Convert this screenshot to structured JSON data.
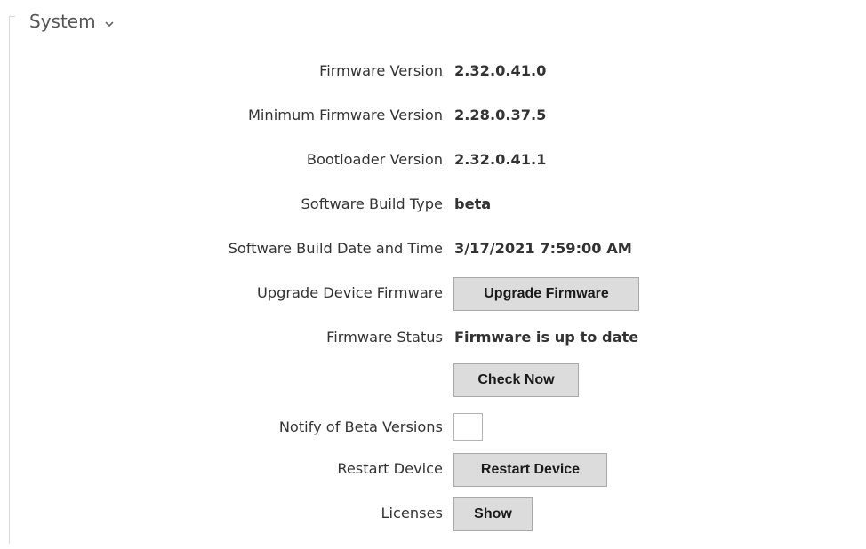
{
  "section": {
    "title": "System",
    "chevron_icon": "chevron-down-icon"
  },
  "rows": {
    "firmware_version": {
      "label": "Firmware Version",
      "value": "2.32.0.41.0"
    },
    "minimum_firmware_version": {
      "label": "Minimum Firmware Version",
      "value": "2.28.0.37.5"
    },
    "bootloader_version": {
      "label": "Bootloader Version",
      "value": "2.32.0.41.1"
    },
    "software_build_type": {
      "label": "Software Build Type",
      "value": "beta"
    },
    "software_build_date": {
      "label": "Software Build Date and Time",
      "value": "3/17/2021 7:59:00 AM"
    },
    "upgrade_firmware": {
      "label": "Upgrade Device Firmware",
      "button": "Upgrade Firmware"
    },
    "firmware_status": {
      "label": "Firmware Status",
      "value": "Firmware is up to date"
    },
    "check_now": {
      "button": "Check Now"
    },
    "notify_beta": {
      "label": "Notify of Beta Versions",
      "checked": false
    },
    "restart_device": {
      "label": "Restart Device",
      "button": "Restart Device"
    },
    "licenses": {
      "label": "Licenses",
      "button": "Show"
    }
  },
  "colors": {
    "text": "#333333",
    "button_bg": "#dcdcdc",
    "button_border": "#a9a9a9",
    "section_line": "#d9d9d9"
  }
}
